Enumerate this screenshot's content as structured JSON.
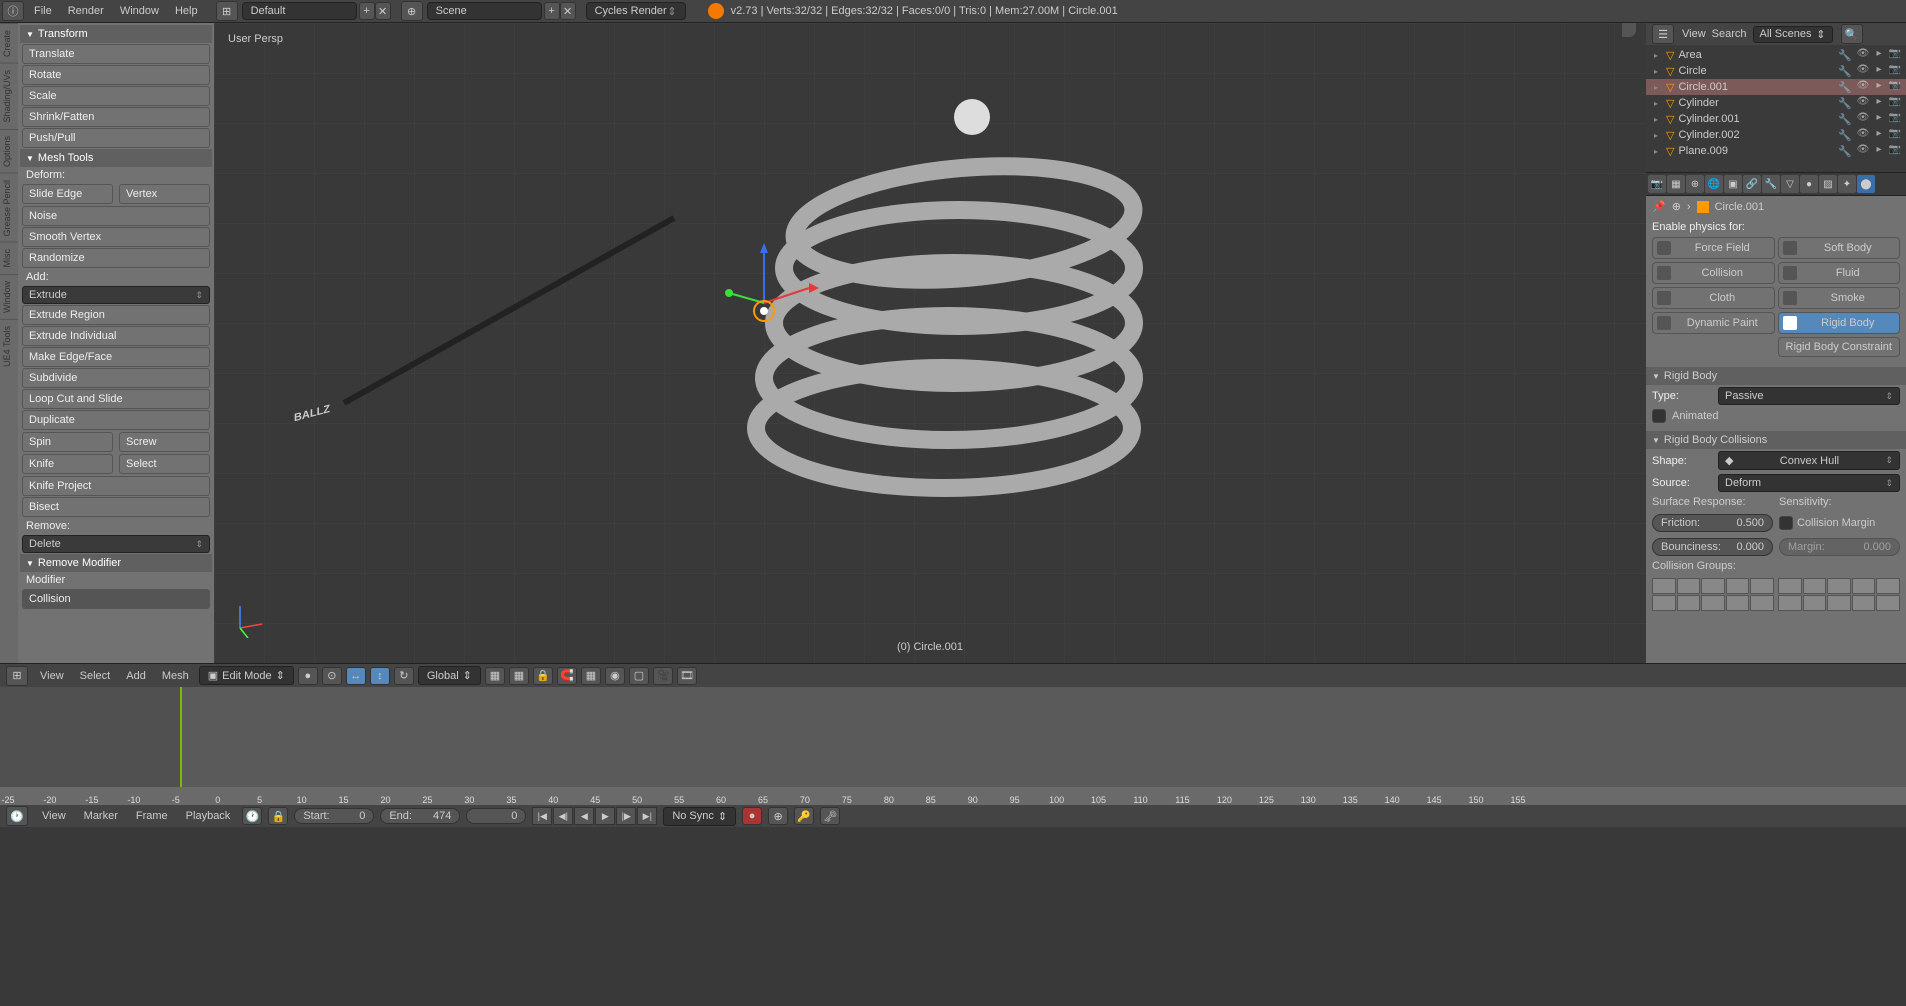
{
  "topbar": {
    "menus": [
      "File",
      "Render",
      "Window",
      "Help"
    ],
    "layout": "Default",
    "scene": "Scene",
    "renderer": "Cycles Render",
    "version": "v2.73",
    "stats": "Verts:32/32 | Edges:32/32 | Faces:0/0 | Tris:0 | Mem:27.00M | Circle.001"
  },
  "left_tabs": [
    "Create",
    "Shading/UVs",
    "Options",
    "Grease Pencil",
    "Misc",
    "Window",
    "UE4 Tools"
  ],
  "tools": {
    "transform_header": "Transform",
    "transform": [
      "Translate",
      "Rotate",
      "Scale",
      "Shrink/Fatten",
      "Push/Pull"
    ],
    "mesh_header": "Mesh Tools",
    "deform_label": "Deform:",
    "slide_edge": "Slide Edge",
    "vertex": "Vertex",
    "noise": "Noise",
    "smooth_vertex": "Smooth Vertex",
    "randomize": "Randomize",
    "add_label": "Add:",
    "extrude": "Extrude",
    "extrude_region": "Extrude Region",
    "extrude_individual": "Extrude Individual",
    "make_edge": "Make Edge/Face",
    "subdivide": "Subdivide",
    "loop_cut": "Loop Cut and Slide",
    "duplicate": "Duplicate",
    "spin": "Spin",
    "screw": "Screw",
    "knife": "Knife",
    "select": "Select",
    "knife_project": "Knife Project",
    "bisect": "Bisect",
    "remove_label": "Remove:",
    "delete": "Delete",
    "op_header": "Remove Modifier",
    "modifier_label": "Modifier",
    "modifier_value": "Collision"
  },
  "viewport": {
    "persp": "User Persp",
    "object": "(0) Circle.001"
  },
  "view_header": {
    "menus": [
      "View",
      "Select",
      "Add",
      "Mesh"
    ],
    "mode": "Edit Mode",
    "orientation": "Global"
  },
  "outliner": {
    "menus": [
      "View",
      "Search"
    ],
    "filter": "All Scenes",
    "items": [
      {
        "name": "Area",
        "icon": "light"
      },
      {
        "name": "Circle",
        "icon": "mesh"
      },
      {
        "name": "Circle.001",
        "icon": "mesh",
        "selected": true
      },
      {
        "name": "Cylinder",
        "icon": "mesh"
      },
      {
        "name": "Cylinder.001",
        "icon": "mesh"
      },
      {
        "name": "Cylinder.002",
        "icon": "mesh"
      },
      {
        "name": "Plane.009",
        "icon": "mesh"
      }
    ]
  },
  "properties": {
    "breadcrumb": "Circle.001",
    "enable_label": "Enable physics for:",
    "buttons": {
      "force_field": "Force Field",
      "soft_body": "Soft Body",
      "collision": "Collision",
      "fluid": "Fluid",
      "cloth": "Cloth",
      "smoke": "Smoke",
      "dynamic_paint": "Dynamic Paint",
      "rigid_body": "Rigid Body",
      "rigid_constraint": "Rigid Body Constraint"
    },
    "rigid_body_header": "Rigid Body",
    "type_label": "Type:",
    "type_value": "Passive",
    "animated_label": "Animated",
    "collisions_header": "Rigid Body Collisions",
    "shape_label": "Shape:",
    "shape_value": "Convex Hull",
    "source_label": "Source:",
    "source_value": "Deform",
    "surface_response": "Surface Response:",
    "sensitivity": "Sensitivity:",
    "friction_label": "Friction:",
    "friction_value": "0.500",
    "collision_margin": "Collision Margin",
    "bounciness_label": "Bounciness:",
    "bounciness_value": "0.000",
    "margin_label": "Margin:",
    "margin_value": "0.000",
    "collision_groups": "Collision Groups:"
  },
  "timeline": {
    "menus": [
      "View",
      "Marker",
      "Frame",
      "Playback"
    ],
    "start_label": "Start:",
    "start_value": "0",
    "end_label": "End:",
    "end_value": "474",
    "current_value": "0",
    "sync": "No Sync",
    "ruler_ticks": [
      "-25",
      "-20",
      "-15",
      "-10",
      "-5",
      "0",
      "5",
      "10",
      "15",
      "20",
      "25",
      "30",
      "35",
      "40",
      "45",
      "50",
      "55",
      "60",
      "65",
      "70",
      "75",
      "80",
      "85",
      "90",
      "95",
      "100",
      "105",
      "110",
      "115",
      "120",
      "125",
      "130",
      "135",
      "140",
      "145",
      "150",
      "155"
    ]
  }
}
